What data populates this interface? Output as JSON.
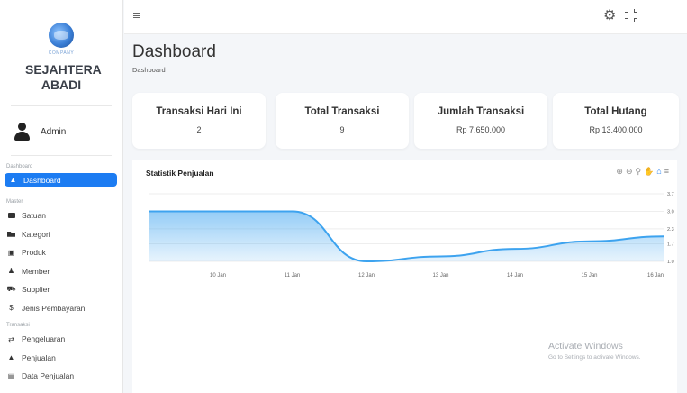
{
  "sidebar": {
    "logo_text": "COMPANY",
    "company_name": "SEJAHTERA ABADI",
    "user": "Admin",
    "sections": {
      "dashboard": "Dashboard",
      "master": "Master",
      "transaksi": "Transaksi"
    },
    "items": [
      {
        "label": "Dashboard",
        "icon": "home-icon"
      },
      {
        "label": "Satuan",
        "icon": "box-icon"
      },
      {
        "label": "Kategori",
        "icon": "folder-icon"
      },
      {
        "label": "Produk",
        "icon": "building-icon"
      },
      {
        "label": "Member",
        "icon": "user-icon"
      },
      {
        "label": "Supplier",
        "icon": "truck-icon"
      },
      {
        "label": "Jenis Pembayaran",
        "icon": "dollar-icon"
      },
      {
        "label": "Pengeluaran",
        "icon": "swap-icon"
      },
      {
        "label": "Penjualan",
        "icon": "flask-icon"
      },
      {
        "label": "Data Penjualan",
        "icon": "chart-icon"
      }
    ]
  },
  "header": {
    "page_title": "Dashboard",
    "breadcrumb": "Dashboard"
  },
  "cards": [
    {
      "title": "Transaksi Hari Ini",
      "value": "2"
    },
    {
      "title": "Total Transaksi",
      "value": "9"
    },
    {
      "title": "Jumlah Transaksi",
      "value": "Rp 7.650.000"
    },
    {
      "title": "Total Hutang",
      "value": "Rp 13.400.000"
    }
  ],
  "chart": {
    "title": "Statistik Penjualan",
    "color": "#3da3ef"
  },
  "chart_data": {
    "type": "area",
    "title": "Statistik Penjualan",
    "categories": [
      "10 Jan",
      "11 Jan",
      "12 Jan",
      "13 Jan",
      "14 Jan",
      "15 Jan",
      "16 Jan"
    ],
    "series": [
      {
        "values": [
          3.0,
          3.0,
          1.0,
          1.2,
          1.5,
          1.8,
          2.0
        ]
      }
    ],
    "y_ticks": [
      "3.7",
      "3.0",
      "2.3",
      "1.7",
      "1.0"
    ],
    "ylim": [
      1.0,
      3.7
    ],
    "grid": true
  },
  "watermark": {
    "line1": "Activate Windows",
    "line2": "Go to Settings to activate Windows."
  }
}
